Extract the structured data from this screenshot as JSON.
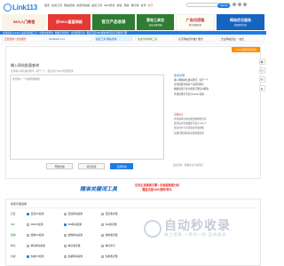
{
  "header": {
    "logo_text": "Link113",
    "nav": [
      {
        "label": "首页",
        "highlight": false
      },
      {
        "label": "在线工具",
        "highlight": false
      },
      {
        "label": "网站查询",
        "highlight": false
      },
      {
        "label": "关键词挖掘",
        "highlight": false
      },
      {
        "label": "站长工具",
        "highlight": false
      },
      {
        "label": "SEO优化",
        "highlight": false
      },
      {
        "label": "友链",
        "highlight": false
      },
      {
        "label": "导航",
        "highlight": false
      },
      {
        "label": "排行榜",
        "highlight": false
      },
      {
        "label": "资讯",
        "highlight": false
      },
      {
        "label": "关于",
        "highlight": true
      }
    ],
    "search_button": "OpenAI"
  },
  "ads": {
    "a1": "SEO入门教程",
    "a2": "好SEO/星星网络",
    "a3": "官方产品收录",
    "a4_title": "爱站工具包",
    "a4_sub": "站长必备利器",
    "a5_title": "广告位招租",
    "a5_sub": "联系客服咨询",
    "a6_title": "网站优化服务",
    "a6_sub": "快速提升排名"
  },
  "notice": "欢迎使用 Link113 关键词挖掘工具 · 免费在线查询 · 数据实时更新 · 支持批量导出 · 覆盖百度/360/搜狗/神马等主流搜索引擎",
  "ads2": {
    "b1": "百度权重7 优化服务",
    "b2": "NANEWS.com",
    "b3": "站长工具·网站查询",
    "b4": "在线字体转换工具",
    "b5": "北京网站优化推广服务",
    "b6": "企业网站建设 一站式"
  },
  "form": {
    "corner_tag": "1-10 关键词免费查询",
    "title": "输入网站批量查询",
    "subtitle": "支持输入域名或关键词，每行一个，最多支持 500 条批量查询",
    "placeholder": "每行输入一个关键词或域名",
    "help_title": "使用说明",
    "help_lines": [
      "输入网站域名或关键词，每行一个",
      "支持批量查询多个关键词排名",
      "数据来源于各大搜索引擎实时抓取",
      "查询结果可导出为 Excel 表格",
      "",
      "",
      "",
      "",
      "温馨提示：",
      "查询频率过快可能会被限制访问",
      "建议每次查询数量不超过 100 个",
      "会员用户可享受更多查询次数",
      "如遇问题请联系在线客服处理"
    ],
    "help_foot": "最后更新：数据每日自动同步",
    "btn_search": "开始查询",
    "btn_clear": "清空列表",
    "btn_submit": "立即查询"
  },
  "slogan": {
    "left": "精准关键词工具",
    "right_line1": "支持主流搜索引擎 / 多维度数据分析",
    "right_line2": "覆盖百度/360/搜狗/神马"
  },
  "lower": {
    "title": "搜索引擎选择",
    "rows": [
      {
        "engine": "百度",
        "items": [
          "百度PC权重",
          "百度移动权重",
          "百度收录量",
          "百度索引"
        ],
        "checked": [
          true,
          false,
          false,
          false
        ]
      },
      {
        "engine": "360",
        "items": [
          "360PC权重",
          "360移动权重",
          "360收录量",
          "360索引"
        ],
        "checked": [
          false,
          true,
          false,
          false
        ]
      },
      {
        "engine": "搜狗",
        "items": [
          "搜狗PC权重",
          "搜狗移动权重",
          "搜狗收录量",
          "搜狗索引"
        ],
        "checked": [
          false,
          false,
          false,
          false
        ]
      },
      {
        "engine": "神马",
        "items": [
          "神马移动权重",
          "神马收录量",
          "神马索引",
          "神马排名"
        ],
        "checked": [
          false,
          false,
          false,
          false
        ]
      },
      {
        "engine": "谷歌",
        "items": [
          "谷歌PC权重",
          "谷歌移动权重",
          "谷歌收录量",
          "谷歌索引"
        ],
        "checked": [
          true,
          false,
          false,
          false
        ]
      }
    ]
  },
  "watermark": {
    "title": "自动秒收录",
    "sub": "做上链接 一来访一秒 自动收录"
  },
  "colors": {
    "brand": "#1e7be6",
    "accent_red": "#e53935",
    "accent_green": "#2e7d32",
    "accent_orange": "#ff8f00"
  },
  "icons": [
    "logo-icon",
    "user-icon",
    "grid-icon",
    "chat-icon",
    "qq-icon",
    "wechat-icon",
    "top-icon"
  ]
}
